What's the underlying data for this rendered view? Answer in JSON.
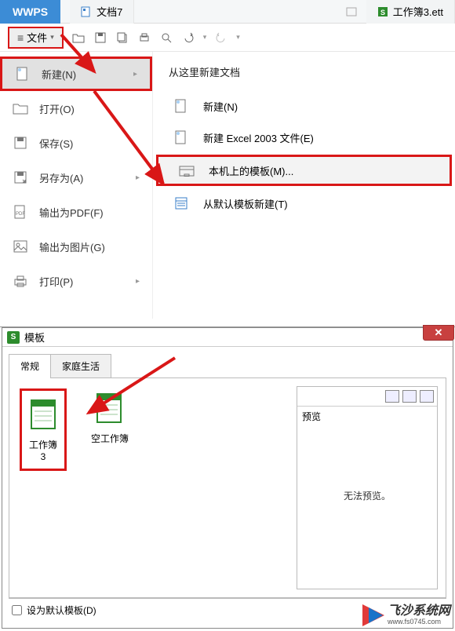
{
  "topbar": {
    "wps_label": "WPS",
    "tab1": "文档7",
    "tab2": "工作簿3.ett"
  },
  "toolbar": {
    "file_label": "文件"
  },
  "left_menu": {
    "new": "新建(N)",
    "open": "打开(O)",
    "save": "保存(S)",
    "saveas": "另存为(A)",
    "export_pdf": "输出为PDF(F)",
    "export_img": "输出为图片(G)",
    "print": "打印(P)"
  },
  "right_panel": {
    "heading": "从这里新建文档",
    "new": "新建(N)",
    "new_excel2003": "新建 Excel 2003 文件(E)",
    "local_template": "本机上的模板(M)...",
    "default_template": "从默认模板新建(T)"
  },
  "dialog": {
    "title": "模板",
    "tab_general": "常规",
    "tab_family": "家庭生活",
    "template1": "工作簿3",
    "template2": "空工作簿",
    "preview_label": "预览",
    "preview_empty": "无法预览。",
    "set_default": "设为默认模板(D)"
  },
  "watermark": {
    "line1": "飞沙系统网",
    "line2": "www.fs0745.com"
  }
}
